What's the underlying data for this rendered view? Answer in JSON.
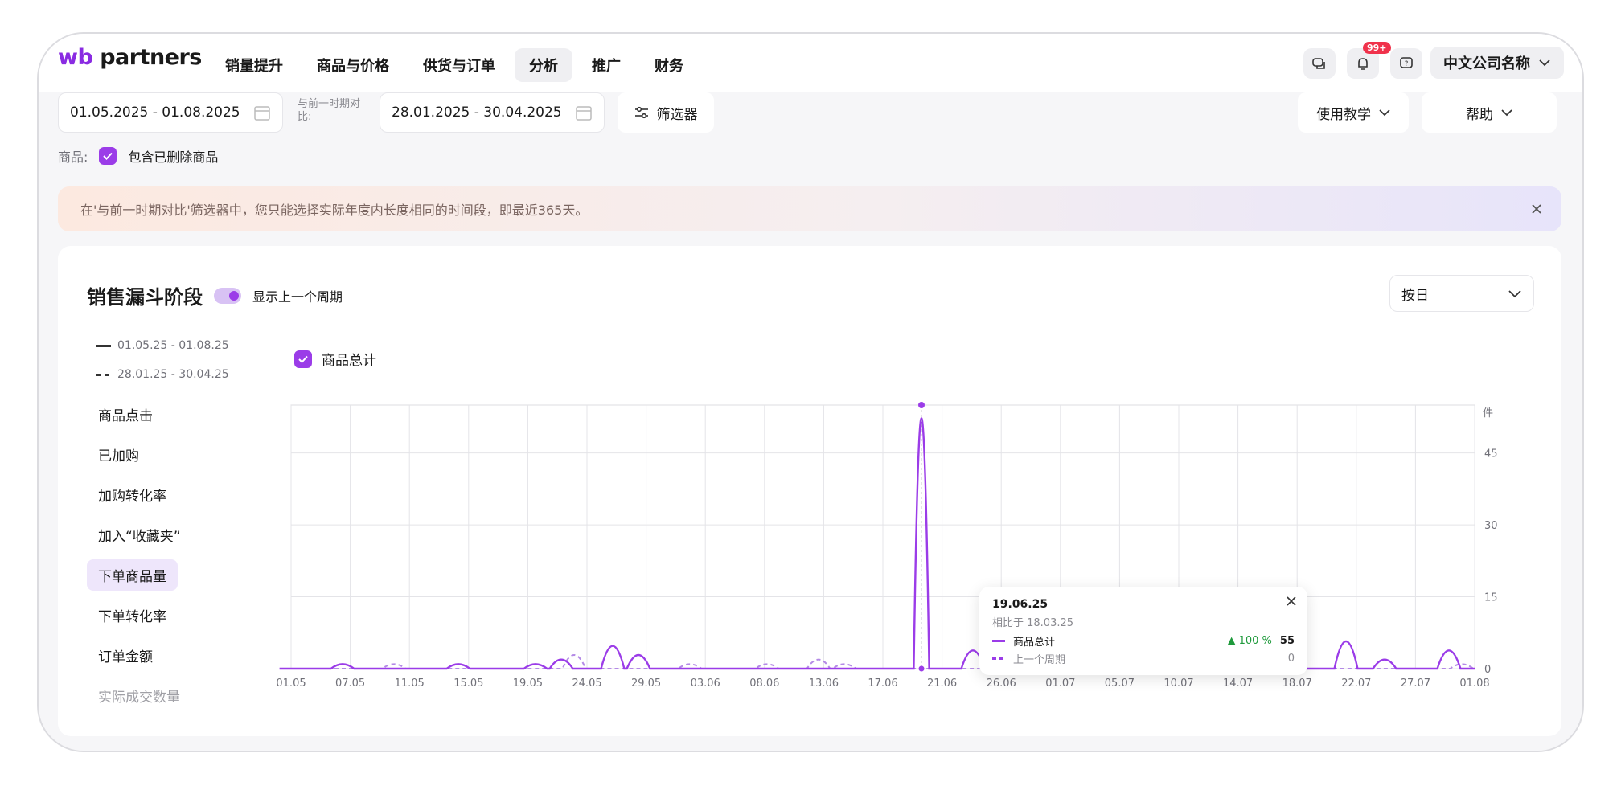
{
  "app": {
    "logo_prefix": "wb",
    "logo_suffix": "partners"
  },
  "nav": {
    "items": [
      "销量提升",
      "商品与价格",
      "供货与订单",
      "分析",
      "推广",
      "财务"
    ],
    "active": "分析"
  },
  "header": {
    "notification_badge": "99+",
    "company_name": "中文公司名称"
  },
  "filters": {
    "period": "01.05.2025 - 01.08.2025",
    "compare_label": "与前一时期对比:",
    "compare_period": "28.01.2025 - 30.04.2025",
    "filter_button": "筛选器",
    "tutorial_button": "使用教学",
    "help_button": "帮助",
    "products_label": "商品:",
    "include_deleted": "包含已删除商品"
  },
  "banner": {
    "text": "在'与前一时期对比'筛选器中，您只能选择实际年度内长度相同的时间段，即最近365天。"
  },
  "funnel": {
    "title": "销售漏斗阶段",
    "toggle_label": "显示上一个周期",
    "granularity": "按日",
    "legend_current": "01.05.25 - 01.08.25",
    "legend_previous": "28.01.25 - 30.04.25",
    "series_checkbox": "商品总计",
    "metrics": [
      "商品点击",
      "已加购",
      "加购转化率",
      "加入“收藏夹”",
      "下单商品量",
      "下单转化率",
      "订单金额",
      "实际成交数量"
    ],
    "active_metric": "下单商品量"
  },
  "tooltip": {
    "date": "19.06.25",
    "compare": "相比于 18.03.25",
    "series_label": "商品总计",
    "change": "100 %",
    "value": "55",
    "prev_label": "上一个周期",
    "prev_value": "0"
  },
  "colors": {
    "accent": "#9b3ce8",
    "previous": "#b48ae6",
    "positive": "#1f9a3c"
  },
  "chart_data": {
    "type": "line",
    "unit": "件",
    "x_ticks": [
      "01.05",
      "07.05",
      "11.05",
      "15.05",
      "19.05",
      "24.05",
      "29.05",
      "03.06",
      "08.06",
      "13.06",
      "17.06",
      "21.06",
      "26.06",
      "01.07",
      "05.07",
      "10.07",
      "14.07",
      "18.07",
      "22.07",
      "27.07",
      "01.08"
    ],
    "y_ticks": [
      0,
      15,
      30,
      45
    ],
    "ylim": [
      0,
      55
    ],
    "series": [
      {
        "name": "01.05.25 - 01.08.25",
        "points": [
          [
            0,
            0
          ],
          [
            4,
            1
          ],
          [
            13,
            1
          ],
          [
            19,
            1
          ],
          [
            21,
            2
          ],
          [
            25,
            5
          ],
          [
            27,
            3
          ],
          [
            49,
            55
          ],
          [
            53,
            4
          ],
          [
            56,
            1
          ],
          [
            62,
            1
          ],
          [
            67,
            1
          ],
          [
            68,
            14
          ],
          [
            71,
            4
          ],
          [
            75,
            6
          ],
          [
            82,
            6
          ],
          [
            85,
            2
          ],
          [
            90,
            4
          ]
        ]
      },
      {
        "name": "28.01.25 - 30.04.25",
        "points": [
          [
            8,
            1
          ],
          [
            22,
            3
          ],
          [
            31,
            1
          ],
          [
            37,
            1
          ],
          [
            41,
            2
          ],
          [
            43,
            1
          ],
          [
            55,
            1
          ],
          [
            59,
            1
          ],
          [
            62,
            1
          ],
          [
            64,
            1
          ],
          [
            66,
            1
          ],
          [
            70,
            1
          ],
          [
            91,
            1
          ]
        ]
      }
    ]
  }
}
